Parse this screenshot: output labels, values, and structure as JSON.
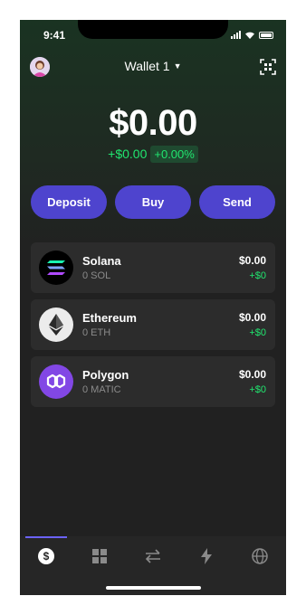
{
  "status": {
    "time": "9:41"
  },
  "header": {
    "wallet_title": "Wallet 1"
  },
  "balance": {
    "total": "$0.00",
    "change_abs": "+$0.00",
    "change_pct": "+0.00%"
  },
  "actions": [
    {
      "label": "Deposit"
    },
    {
      "label": "Buy"
    },
    {
      "label": "Send"
    }
  ],
  "tokens": [
    {
      "name": "Solana",
      "amount": "0 SOL",
      "value": "$0.00",
      "change": "+$0",
      "icon": "solana-icon",
      "color": "#000000"
    },
    {
      "name": "Ethereum",
      "amount": "0 ETH",
      "value": "$0.00",
      "change": "+$0",
      "icon": "ethereum-icon",
      "color": "#ececec"
    },
    {
      "name": "Polygon",
      "amount": "0 MATIC",
      "value": "$0.00",
      "change": "+$0",
      "icon": "polygon-icon",
      "color": "#8247e5"
    }
  ],
  "tabs": [
    {
      "icon": "dollar-icon",
      "active": true
    },
    {
      "icon": "grid-icon",
      "active": false
    },
    {
      "icon": "swap-icon",
      "active": false
    },
    {
      "icon": "lightning-icon",
      "active": false
    },
    {
      "icon": "globe-icon",
      "active": false
    }
  ],
  "colors": {
    "accent": "#4e44ce",
    "positive": "#21e56f",
    "tab_active": "#6c63ff"
  }
}
